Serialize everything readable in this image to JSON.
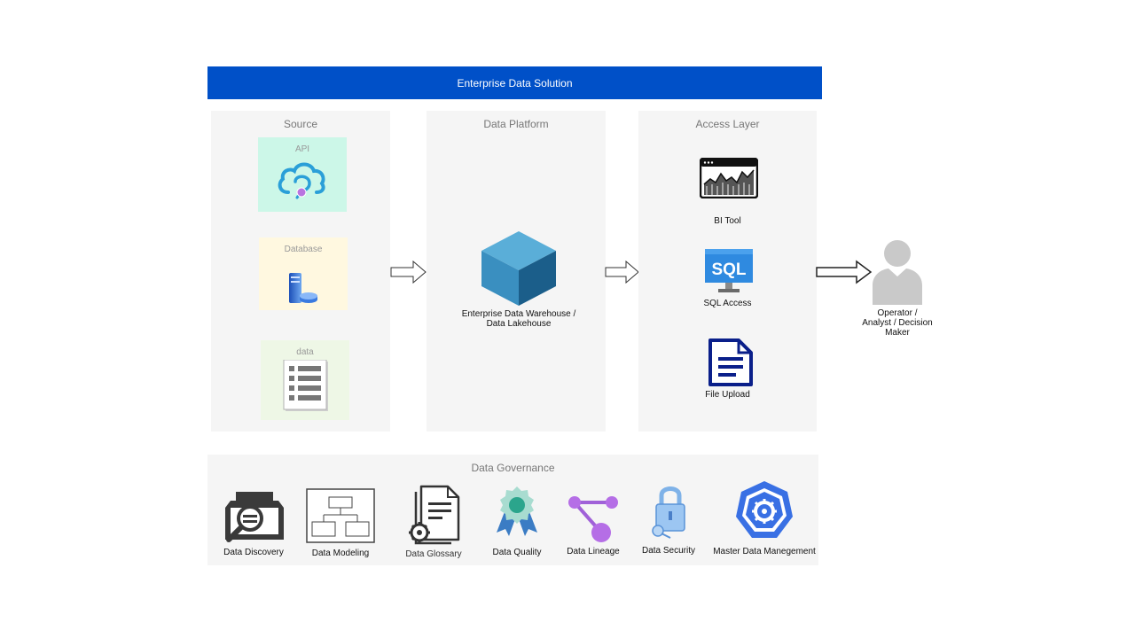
{
  "header": {
    "title": "Enterprise Data Solution"
  },
  "source": {
    "title": "Source",
    "items": [
      {
        "label": "API",
        "icon": "cloud-api-icon",
        "bg": "#ccf7e8"
      },
      {
        "label": "Database",
        "icon": "database-server-icon",
        "bg": "#fff8e0"
      },
      {
        "label": "data",
        "icon": "list-document-icon",
        "bg": "#eef7e6"
      }
    ]
  },
  "platform": {
    "title": "Data Platform",
    "item": {
      "label": "Enterprise Data Warehouse / Data Lakehouse",
      "icon": "cube-icon"
    }
  },
  "access": {
    "title": "Access Layer",
    "items": [
      {
        "label": "BI Tool",
        "icon": "dashboard-chart-icon"
      },
      {
        "label": "SQL Access",
        "icon": "sql-monitor-icon"
      },
      {
        "label": "File Upload",
        "icon": "file-icon"
      }
    ]
  },
  "consumer": {
    "label": "Operator / Analyst / Decision Maker",
    "icon": "person-icon"
  },
  "governance": {
    "title": "Data Governance",
    "items": [
      {
        "label": "Data Discovery",
        "icon": "discovery-icon"
      },
      {
        "label": "Data Modeling",
        "icon": "modeling-icon"
      },
      {
        "label": "Data Glossary",
        "icon": "glossary-icon"
      },
      {
        "label": "Data Quality",
        "icon": "quality-badge-icon"
      },
      {
        "label": "Data Lineage",
        "icon": "lineage-icon"
      },
      {
        "label": "Data Security",
        "icon": "security-lock-icon"
      },
      {
        "label": "Master Data Manegement",
        "icon": "master-data-icon"
      }
    ]
  },
  "colors": {
    "header": "#0050c8",
    "panel": "#f5f5f5",
    "cube_light": "#3a8fc0",
    "cube_dark": "#1b5e8a",
    "kubernetes_blue": "#3970e4"
  }
}
